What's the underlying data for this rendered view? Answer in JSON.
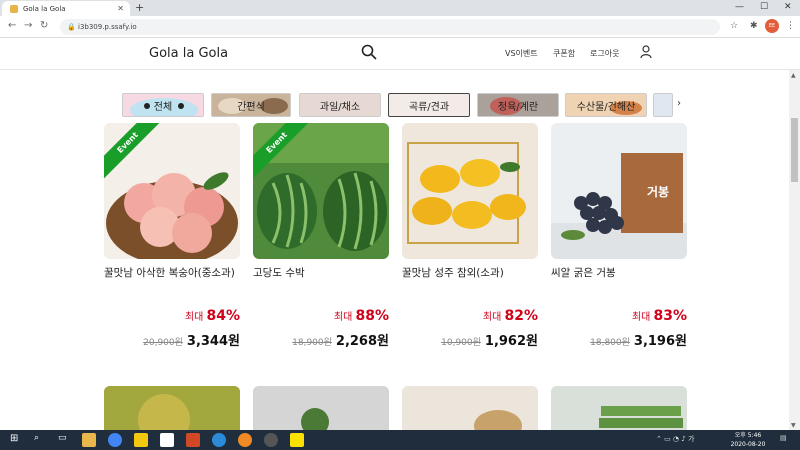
{
  "browser": {
    "tab_title": "Gola la Gola",
    "url": "i3b309.p.ssafy.io",
    "profile_initials": "EE"
  },
  "site": {
    "brand": "Gola la Gola",
    "nav": [
      "VS이벤트",
      "쿠폰함",
      "로그아웃"
    ]
  },
  "categories": [
    {
      "label": "전체",
      "active": false
    },
    {
      "label": "간편식",
      "active": false
    },
    {
      "label": "과일/채소",
      "active": false
    },
    {
      "label": "곡류/견과",
      "active": true
    },
    {
      "label": "정육/계란",
      "active": false
    },
    {
      "label": "수산물/건해산",
      "active": false
    }
  ],
  "products": [
    {
      "name": "꿀맛남 아삭한 복숭아(중소과)",
      "event": "Event",
      "disc_prefix": "최대",
      "disc": "84%",
      "orig": "20,900원",
      "price": "3,344원"
    },
    {
      "name": "고당도 수박",
      "event": "Event",
      "disc_prefix": "최대",
      "disc": "88%",
      "orig": "18,900원",
      "price": "2,268원"
    },
    {
      "name": "꿀맛남 성주 참외(소과)",
      "event": "",
      "disc_prefix": "최대",
      "disc": "82%",
      "orig": "10,900원",
      "price": "1,962원"
    },
    {
      "name": "씨알 굵은 거봉",
      "event": "",
      "disc_prefix": "최대",
      "disc": "83%",
      "orig": "18,800원",
      "price": "3,196원",
      "box_text": "거봉"
    }
  ],
  "clock": {
    "time": "오후 5:46",
    "date": "2020-08-20"
  },
  "colors": {
    "accent_red": "#d0021b",
    "event_green": "#1a9e2a"
  }
}
